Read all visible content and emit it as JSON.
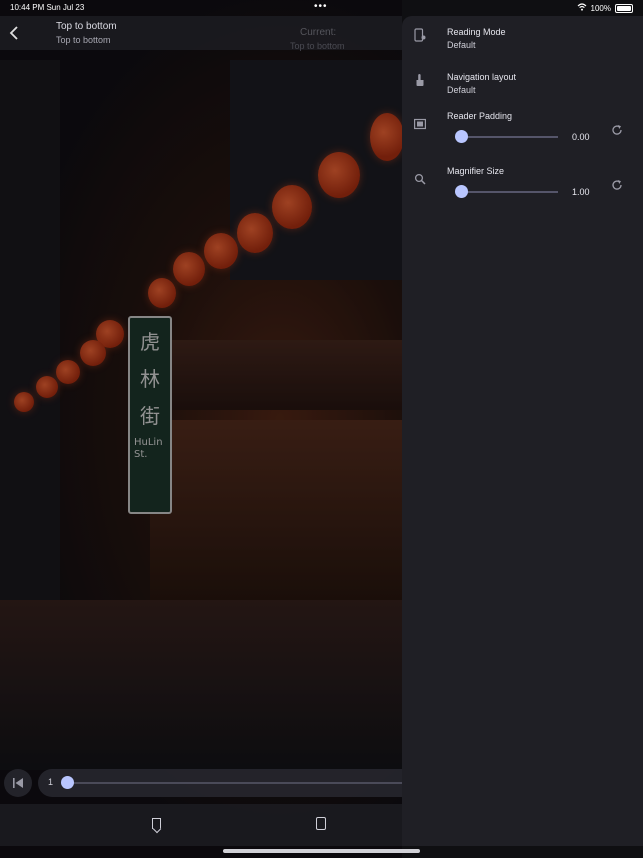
{
  "status_bar": {
    "time": "10:44 PM  Sun Jul 23",
    "dots": "•••",
    "battery": "100%"
  },
  "reader_top_bar": {
    "title": "Top to bottom",
    "subtitle": "Top to bottom",
    "current_label": "Current:",
    "current_value": "Top to bottom"
  },
  "sign": {
    "chars": [
      "虎",
      "林",
      "街"
    ],
    "latin": "HuLin St."
  },
  "page_bar": {
    "page_number": "1",
    "progress": 0
  },
  "settings_panel": {
    "reading_mode": {
      "title": "Reading Mode",
      "value": "Default",
      "icon": "phone-settings-icon"
    },
    "navigation_layout": {
      "title": "Navigation layout",
      "value": "Default",
      "icon": "touch-icon"
    },
    "reader_padding": {
      "title": "Reader Padding",
      "value": "0.00",
      "slider_fraction": 0,
      "icon": "padding-icon"
    },
    "magnifier_size": {
      "title": "Magnifier Size",
      "value": "1.00",
      "slider_fraction": 0,
      "icon": "magnifier-icon"
    }
  },
  "colors": {
    "panel_bg": "#1f1f25",
    "accent": "#b9c6ff"
  }
}
